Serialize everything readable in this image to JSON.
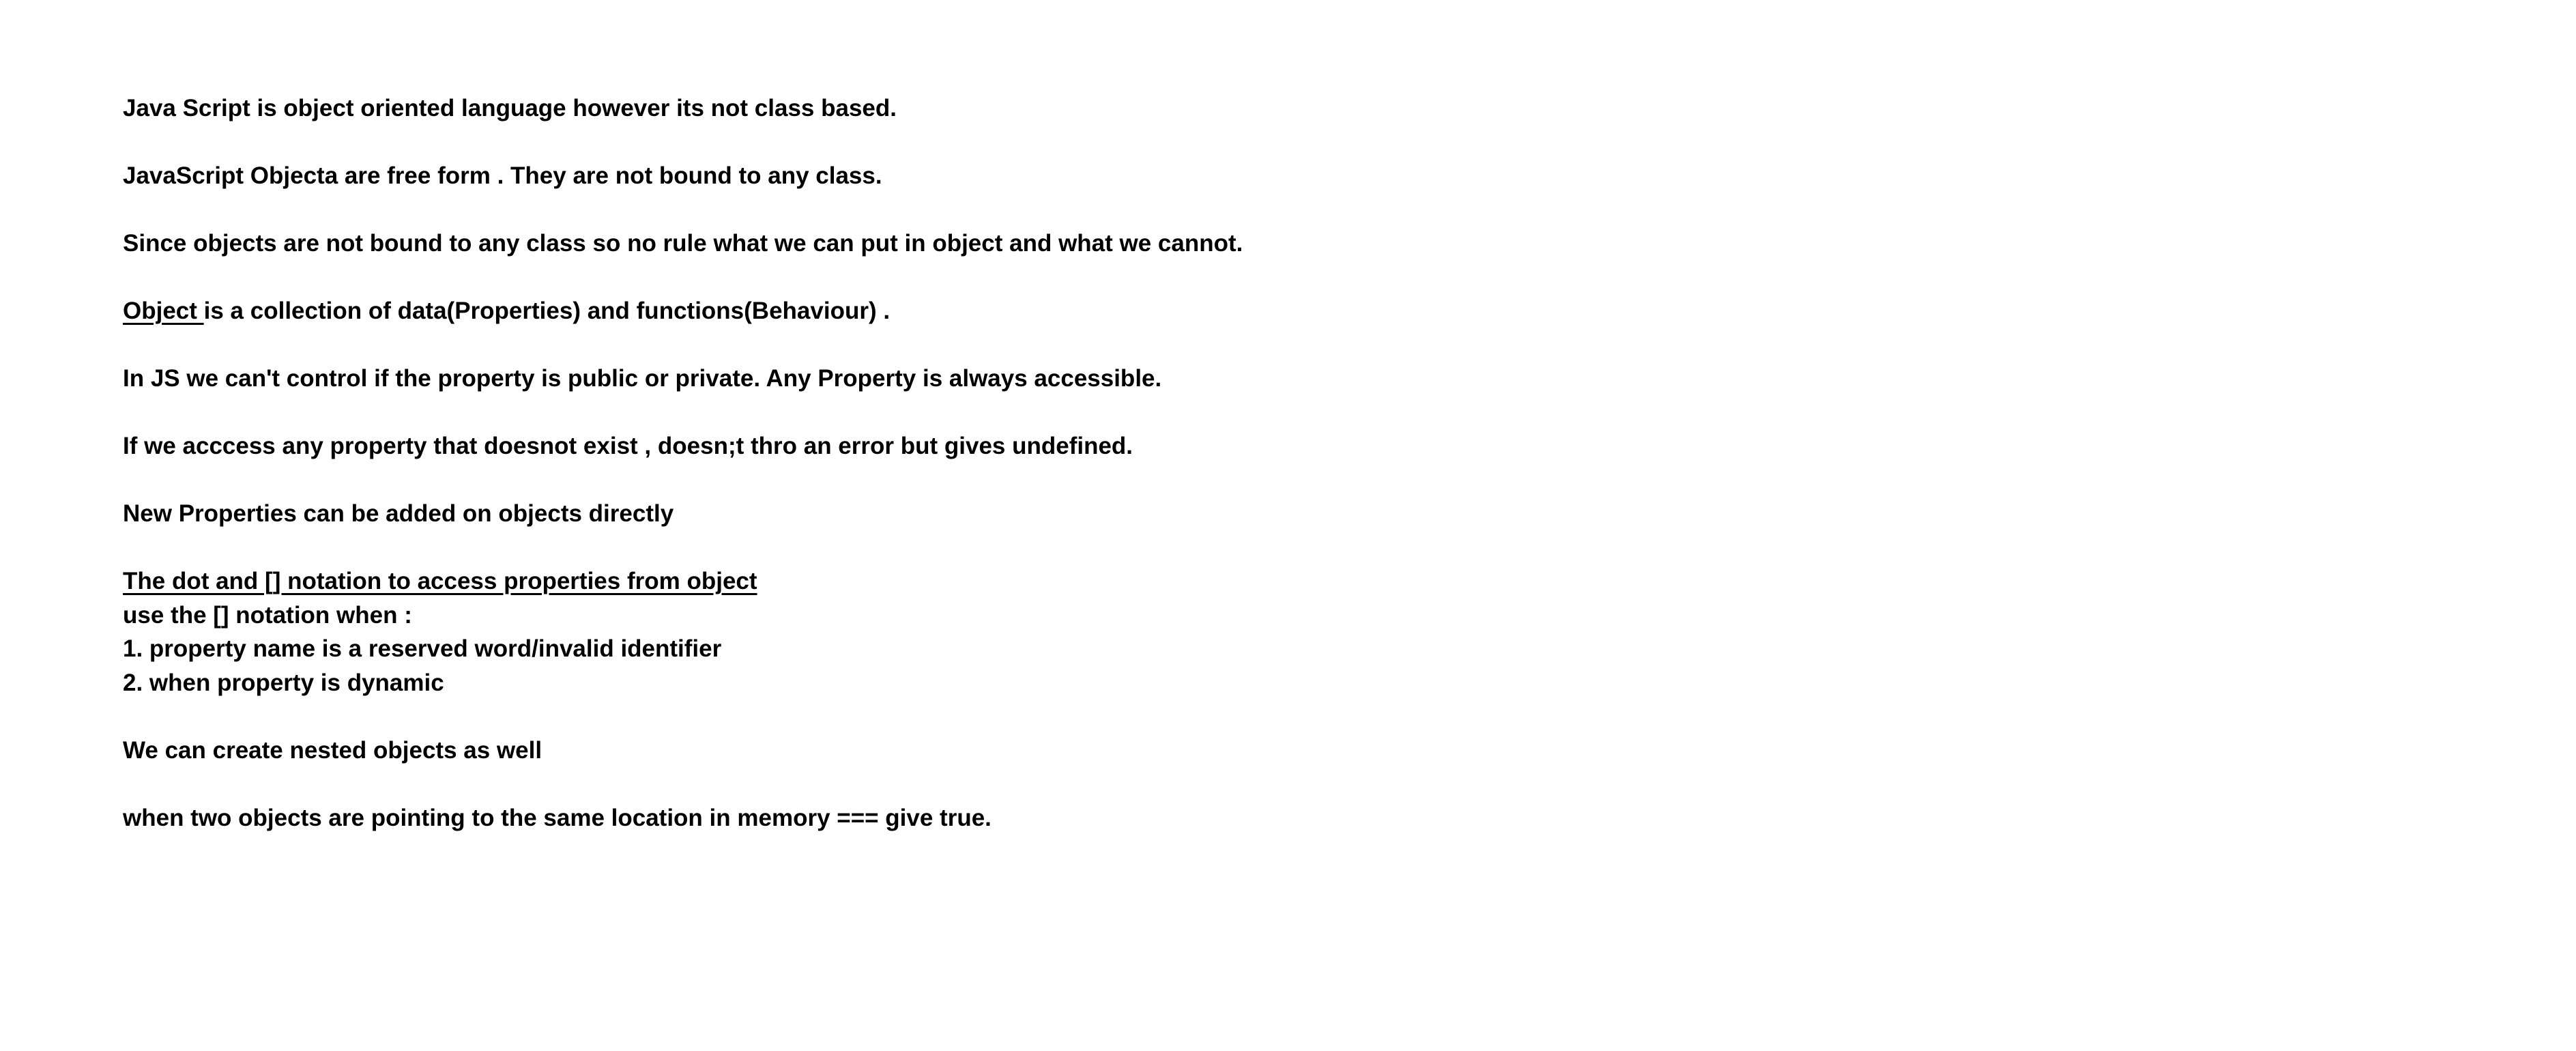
{
  "notes": {
    "l1": "Java Script is object oriented language however its not class based.",
    "l2": "JavaScript Objecta are free form . They are not bound to any class.",
    "l3": "Since objects are not bound to any class so no rule what we can put in object and what we cannot.",
    "l4_underlined": "Object ",
    "l4_rest": "is a collection of data(Properties) and functions(Behaviour) .",
    "l5": "In JS we can't control if the property is public or private. Any Property is always accessible.",
    "l6": "If we acccess any property that doesnot exist , doesn;t thro an error but gives undefined.",
    "l7": "New Properties can be added on objects directly",
    "l8_heading": "The dot and [] notation to access properties from object",
    "l9": "use the [] notation when :",
    "l10": "1. property name is a reserved word/invalid identifier",
    "l11": "2. when property is dynamic",
    "l12": "We can create nested objects as well",
    "l13": "when two objects are pointing to the same location in memory === give true."
  }
}
